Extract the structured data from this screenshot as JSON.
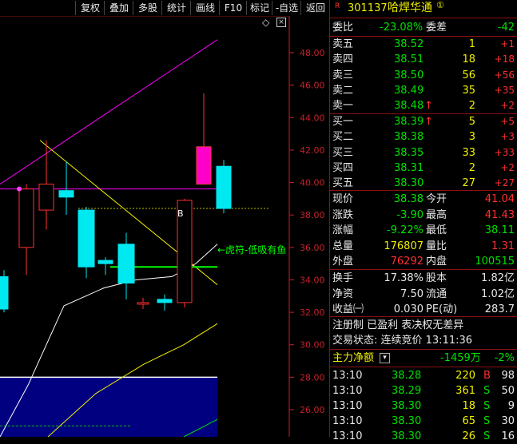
{
  "toolbar": {
    "buttons": [
      "复权",
      "叠加",
      "多股",
      "统计",
      "画线",
      "F10",
      "标记",
      "-自选",
      "返回"
    ]
  },
  "chart": {
    "y_ticks": [
      "48.00",
      "46.00",
      "44.00",
      "42.00",
      "40.00",
      "38.00",
      "36.00",
      "34.00",
      "32.00",
      "30.00",
      "28.00",
      "26.00"
    ],
    "annotation": "←虎符-低吸有鱼",
    "b_marker": "B",
    "colors": {
      "up": "#ff3030",
      "down": "#00e8f0",
      "magenta": "#ff00ff",
      "yellow": "#f0f000",
      "green": "#00ff00",
      "white": "#ffffff",
      "navy": "#000080"
    },
    "candles": [
      {
        "o": 34.2,
        "c": 32.2,
        "h": 34.6,
        "l": 32.0
      },
      {
        "o": 36.0,
        "c": 39.6,
        "h": 39.9,
        "l": 34.3
      },
      {
        "o": 38.3,
        "c": 39.9,
        "h": 42.6,
        "l": 37.1
      },
      {
        "o": 39.5,
        "c": 39.1,
        "h": 41.3,
        "l": 38.0
      },
      {
        "o": 38.3,
        "c": 34.8,
        "h": 38.5,
        "l": 34.1
      },
      {
        "o": 35.2,
        "c": 35.0,
        "h": 35.4,
        "l": 34.3
      },
      {
        "o": 36.2,
        "c": 33.8,
        "h": 36.9,
        "l": 32.8
      },
      {
        "o": 32.6,
        "c": 32.6,
        "h": 32.9,
        "l": 32.2
      },
      {
        "o": 32.8,
        "c": 32.6,
        "h": 33.1,
        "l": 32.1
      },
      {
        "o": 32.6,
        "c": 38.9,
        "h": 39.0,
        "l": 32.3
      },
      {
        "o": 39.9,
        "c": 42.2,
        "h": 45.5,
        "l": 39.9
      },
      {
        "o": 41.0,
        "c": 38.4,
        "h": 41.4,
        "l": 38.1
      }
    ]
  },
  "quote": {
    "badge": "R",
    "code": "301137",
    "name": "哈焊华通",
    "name_mark": "①",
    "wei_bi_label": "委比",
    "wei_bi": "-23.08%",
    "wei_cha_label": "委差",
    "wei_cha": "-42",
    "asks": [
      {
        "label": "卖五",
        "price": "38.52",
        "vol": "1",
        "chg": "+1",
        "arrow": ""
      },
      {
        "label": "卖四",
        "price": "38.51",
        "vol": "18",
        "chg": "+18",
        "arrow": ""
      },
      {
        "label": "卖三",
        "price": "38.50",
        "vol": "56",
        "chg": "+56",
        "arrow": ""
      },
      {
        "label": "卖二",
        "price": "38.49",
        "vol": "35",
        "chg": "+35",
        "arrow": ""
      },
      {
        "label": "卖一",
        "price": "38.48",
        "vol": "2",
        "chg": "+2",
        "arrow": "↑"
      }
    ],
    "bids": [
      {
        "label": "买一",
        "price": "38.39",
        "vol": "5",
        "chg": "+5",
        "arrow": "↑"
      },
      {
        "label": "买二",
        "price": "38.38",
        "vol": "3",
        "chg": "+3",
        "arrow": ""
      },
      {
        "label": "买三",
        "price": "38.35",
        "vol": "33",
        "chg": "+33",
        "arrow": ""
      },
      {
        "label": "买四",
        "price": "38.31",
        "vol": "2",
        "chg": "+2",
        "arrow": ""
      },
      {
        "label": "买五",
        "price": "38.30",
        "vol": "27",
        "chg": "+27",
        "arrow": ""
      }
    ],
    "stats": [
      {
        "l1": "现价",
        "v1": "38.38",
        "c1": "g",
        "l2": "今开",
        "v2": "41.04",
        "c2": "r"
      },
      {
        "l1": "涨跌",
        "v1": "-3.90",
        "c1": "g",
        "l2": "最高",
        "v2": "41.43",
        "c2": "r"
      },
      {
        "l1": "涨幅",
        "v1": "-9.22%",
        "c1": "g",
        "l2": "最低",
        "v2": "38.11",
        "c2": "g"
      },
      {
        "l1": "总量",
        "v1": "176807",
        "c1": "y",
        "l2": "量比",
        "v2": "1.31",
        "c2": "r"
      },
      {
        "l1": "外盘",
        "v1": "76292",
        "c1": "r",
        "l2": "内盘",
        "v2": "100515",
        "c2": "g"
      }
    ],
    "stats2": [
      {
        "l1": "换手",
        "v1": "17.38%",
        "l2": "股本",
        "v2": "1.82亿"
      },
      {
        "l1": "净资",
        "v1": "7.50",
        "l2": "流通",
        "v2": "1.02亿"
      },
      {
        "l1": "收益㈠",
        "v1": "0.030",
        "l2": "PE(动)",
        "v2": "283.7"
      }
    ],
    "register": "注册制 已盈利 表决权无差异",
    "trade_status": "交易状态: 连续竞价 13:11:36",
    "net_label": "主力净额",
    "net_value": "-1459万",
    "net_pct": "-2%",
    "ticks": [
      {
        "time": "13:10",
        "price": "38.28",
        "vol": "220",
        "side": "B",
        "num": "98"
      },
      {
        "time": "13:10",
        "price": "38.29",
        "vol": "361",
        "side": "S",
        "num": "50"
      },
      {
        "time": "13:10",
        "price": "38.30",
        "vol": "18",
        "side": "S",
        "num": "9"
      },
      {
        "time": "13:10",
        "price": "38.30",
        "vol": "65",
        "side": "S",
        "num": "30"
      },
      {
        "time": "13:10",
        "price": "38.30",
        "vol": "26",
        "side": "S",
        "num": "16"
      }
    ]
  }
}
